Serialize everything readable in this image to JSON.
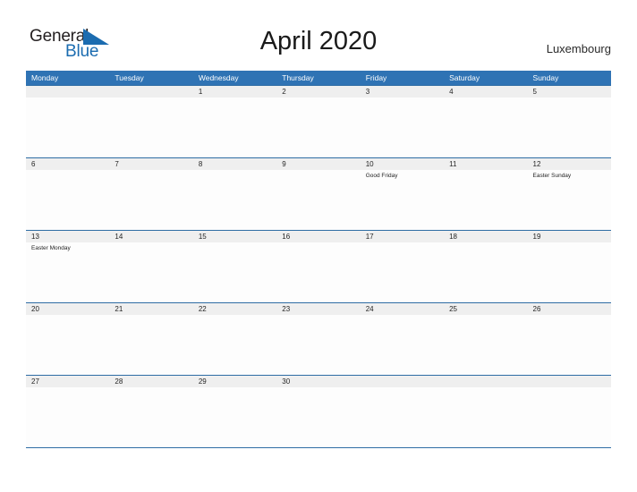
{
  "brand": {
    "name_part1": "General",
    "name_part2": "Blue",
    "flag_icon": "blue-triangle-flag",
    "color_dark": "#231f20",
    "color_blue": "#1b6cb0"
  },
  "header": {
    "title": "April 2020",
    "country": "Luxembourg"
  },
  "theme": {
    "header_bar": "#2f73b4",
    "row_divider": "#2e6da4",
    "date_band": "#efefef",
    "cell_background": "#fdfdfd",
    "weekday_text": "#ffffff"
  },
  "calendar": {
    "weekdays": [
      "Monday",
      "Tuesday",
      "Wednesday",
      "Thursday",
      "Friday",
      "Saturday",
      "Sunday"
    ],
    "weeks": [
      [
        {
          "day": "",
          "event": ""
        },
        {
          "day": "",
          "event": ""
        },
        {
          "day": "1",
          "event": ""
        },
        {
          "day": "2",
          "event": ""
        },
        {
          "day": "3",
          "event": ""
        },
        {
          "day": "4",
          "event": ""
        },
        {
          "day": "5",
          "event": ""
        }
      ],
      [
        {
          "day": "6",
          "event": ""
        },
        {
          "day": "7",
          "event": ""
        },
        {
          "day": "8",
          "event": ""
        },
        {
          "day": "9",
          "event": ""
        },
        {
          "day": "10",
          "event": "Good Friday"
        },
        {
          "day": "11",
          "event": ""
        },
        {
          "day": "12",
          "event": "Easter Sunday"
        }
      ],
      [
        {
          "day": "13",
          "event": "Easter Monday"
        },
        {
          "day": "14",
          "event": ""
        },
        {
          "day": "15",
          "event": ""
        },
        {
          "day": "16",
          "event": ""
        },
        {
          "day": "17",
          "event": ""
        },
        {
          "day": "18",
          "event": ""
        },
        {
          "day": "19",
          "event": ""
        }
      ],
      [
        {
          "day": "20",
          "event": ""
        },
        {
          "day": "21",
          "event": ""
        },
        {
          "day": "22",
          "event": ""
        },
        {
          "day": "23",
          "event": ""
        },
        {
          "day": "24",
          "event": ""
        },
        {
          "day": "25",
          "event": ""
        },
        {
          "day": "26",
          "event": ""
        }
      ],
      [
        {
          "day": "27",
          "event": ""
        },
        {
          "day": "28",
          "event": ""
        },
        {
          "day": "29",
          "event": ""
        },
        {
          "day": "30",
          "event": ""
        },
        {
          "day": "",
          "event": ""
        },
        {
          "day": "",
          "event": ""
        },
        {
          "day": "",
          "event": ""
        }
      ]
    ]
  }
}
